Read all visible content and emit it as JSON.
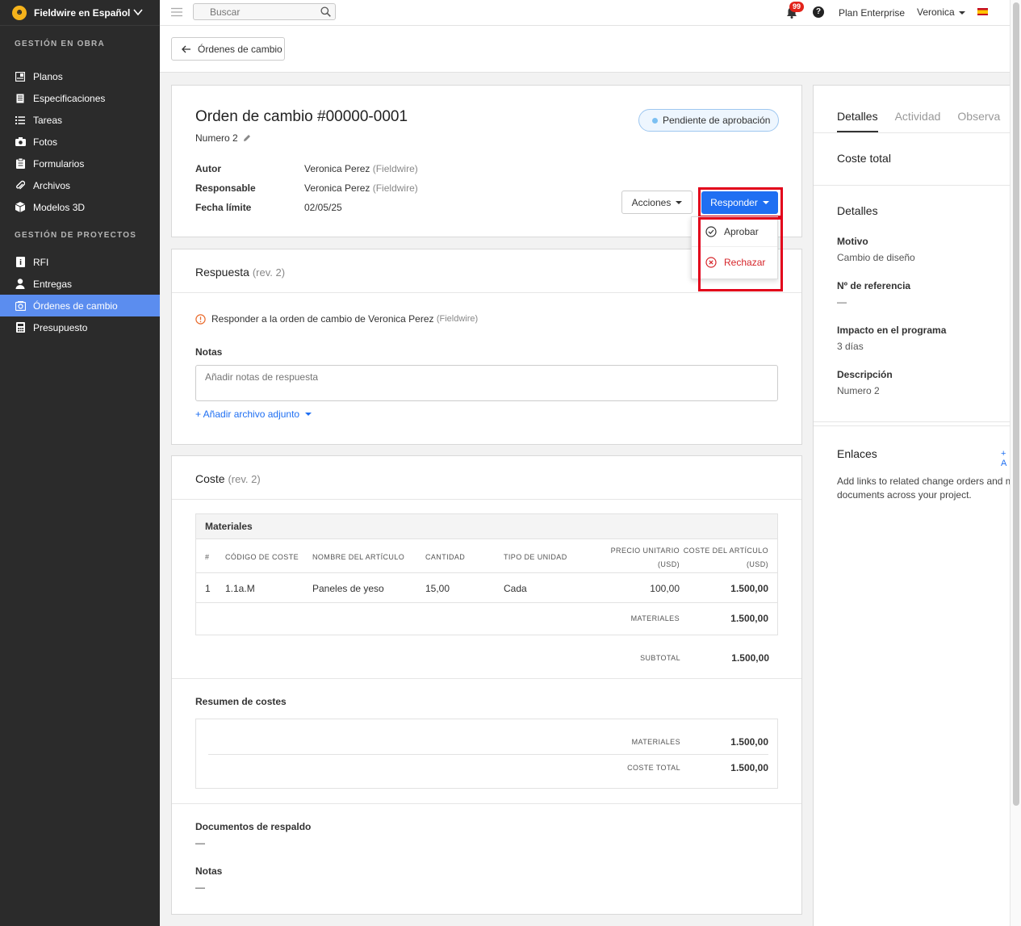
{
  "sidebar": {
    "brand": "Fieldwire en Español",
    "sections": [
      {
        "title": "GESTIÓN EN OBRA",
        "items": [
          {
            "label": "Planos",
            "icon": "plans-icon"
          },
          {
            "label": "Especificaciones",
            "icon": "specs-icon"
          },
          {
            "label": "Tareas",
            "icon": "tasks-icon"
          },
          {
            "label": "Fotos",
            "icon": "camera-icon"
          },
          {
            "label": "Formularios",
            "icon": "forms-icon"
          },
          {
            "label": "Archivos",
            "icon": "paperclip-icon"
          },
          {
            "label": "Modelos 3D",
            "icon": "cube-icon"
          }
        ]
      },
      {
        "title": "GESTIÓN DE PROYECTOS",
        "items": [
          {
            "label": "RFI",
            "icon": "rfi-icon"
          },
          {
            "label": "Entregas",
            "icon": "person-icon"
          },
          {
            "label": "Órdenes de cambio",
            "icon": "change-order-icon",
            "active": true
          },
          {
            "label": "Presupuesto",
            "icon": "calculator-icon"
          }
        ]
      }
    ]
  },
  "topbar": {
    "search_placeholder": "Buscar",
    "notifications": "99",
    "help": "?",
    "plan": "Plan Enterprise",
    "user": "Veronica"
  },
  "back_button": "Órdenes de cambio",
  "order": {
    "title": "Orden de cambio #00000-0001",
    "subtitle": "Numero 2",
    "status": "Pendiente de aprobación",
    "author_label": "Autor",
    "author": "Veronica Perez",
    "author_org": "(Fieldwire)",
    "responsible_label": "Responsable",
    "responsible": "Veronica Perez",
    "responsible_org": "(Fieldwire)",
    "due_label": "Fecha límite",
    "due": "02/05/25",
    "actions_label": "Acciones",
    "respond_label": "Responder",
    "menu": {
      "approve": "Aprobar",
      "reject": "Rechazar"
    }
  },
  "response": {
    "title": "Respuesta",
    "rev": "(rev. 2)",
    "prompt": "Responder a la orden de cambio de Veronica Perez",
    "prompt_org": "(Fieldwire)",
    "notes_label": "Notas",
    "notes_placeholder": "Añadir notas de respuesta",
    "attach": "+ Añadir archivo adjunto"
  },
  "cost": {
    "title": "Coste",
    "rev": "(rev. 2)",
    "materials_title": "Materiales",
    "columns": [
      "#",
      "CÓDIGO DE COSTE",
      "NOMBRE DEL ARTÍCULO",
      "CANTIDAD",
      "TIPO DE UNIDAD",
      "PRECIO UNITARIO",
      "(USD)",
      "COSTE DEL ARTÍCULO",
      "(USD)"
    ],
    "rows": [
      {
        "num": "1",
        "code": "1.1a.M",
        "name": "Paneles de yeso",
        "qty": "15,00",
        "unit": "Cada",
        "price": "100,00",
        "total": "1.500,00"
      }
    ],
    "materials_total_label": "MATERIALES",
    "materials_total": "1.500,00",
    "subtotal_label": "SUBTOTAL",
    "subtotal": "1.500,00",
    "summary_title": "Resumen de costes",
    "summary_materials_label": "MATERIALES",
    "summary_materials": "1.500,00",
    "summary_total_label": "COSTE TOTAL",
    "summary_total": "1.500,00",
    "docs_label": "Documentos de respaldo",
    "docs_value": "—",
    "notes_label": "Notas",
    "notes_value": "—"
  },
  "right": {
    "tabs": [
      "Detalles",
      "Actividad",
      "Observa"
    ],
    "total_cost_label": "Coste total",
    "details_title": "Detalles",
    "motive_label": "Motivo",
    "motive": "Cambio de diseño",
    "ref_label": "Nº de referencia",
    "ref": "—",
    "impact_label": "Impacto en el programa",
    "impact": "3 días",
    "desc_label": "Descripción",
    "desc": "Numero 2",
    "links_title": "Enlaces",
    "links_add": "+ A",
    "links_text": "Add links to related change orders and mo documents across your project."
  },
  "colors": {
    "accent": "#1f6ff2",
    "sidebar": "#2b2b2b",
    "active_nav": "#5b8def",
    "reject": "#d6262b",
    "highlight": "#e2001a"
  }
}
